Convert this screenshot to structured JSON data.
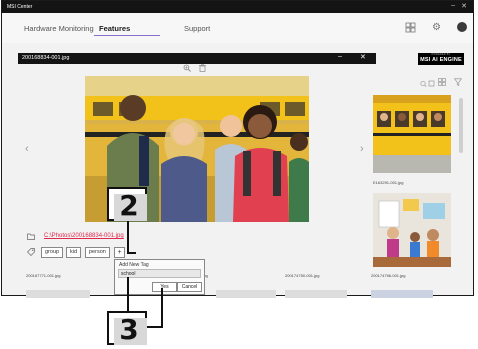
{
  "app": {
    "title": "MSI Center"
  },
  "nav": {
    "tabs": [
      {
        "label": "Hardware Monitoring"
      },
      {
        "label": "Features"
      },
      {
        "label": "Support"
      }
    ]
  },
  "viewer": {
    "filename": "200168834-001.jpg",
    "brand_small": "POWERED BY",
    "brand": "MSI AI ENGINE",
    "filepath": "C:\\Photos\\200168834-001.jpg",
    "tags": [
      "group",
      "kid",
      "person"
    ],
    "add_tag_label": "+"
  },
  "thumbstrip": {
    "labels": [
      "200167771-001.jpg",
      "169877-001.jpg",
      "200174750-001.jpg",
      "200174756-001.jpg"
    ]
  },
  "right_panel": {
    "thumb1_label": "E163291-001.jpg"
  },
  "popup": {
    "title": "Add New Tag",
    "value": "school",
    "yes_label": "Yes",
    "cancel_label": "Cancel"
  },
  "callouts": [
    "2",
    "3"
  ],
  "colors": {
    "accent": "#8a6fd0",
    "filepath": "#e0284a",
    "titlebar": "#141414"
  },
  "icons": {
    "zoom": "zoom-icon",
    "trash": "trash-icon",
    "folder": "folder-icon",
    "tag": "tag-icon",
    "grid": "grid-icon",
    "filter": "filter-icon",
    "settings": "gear-icon"
  }
}
